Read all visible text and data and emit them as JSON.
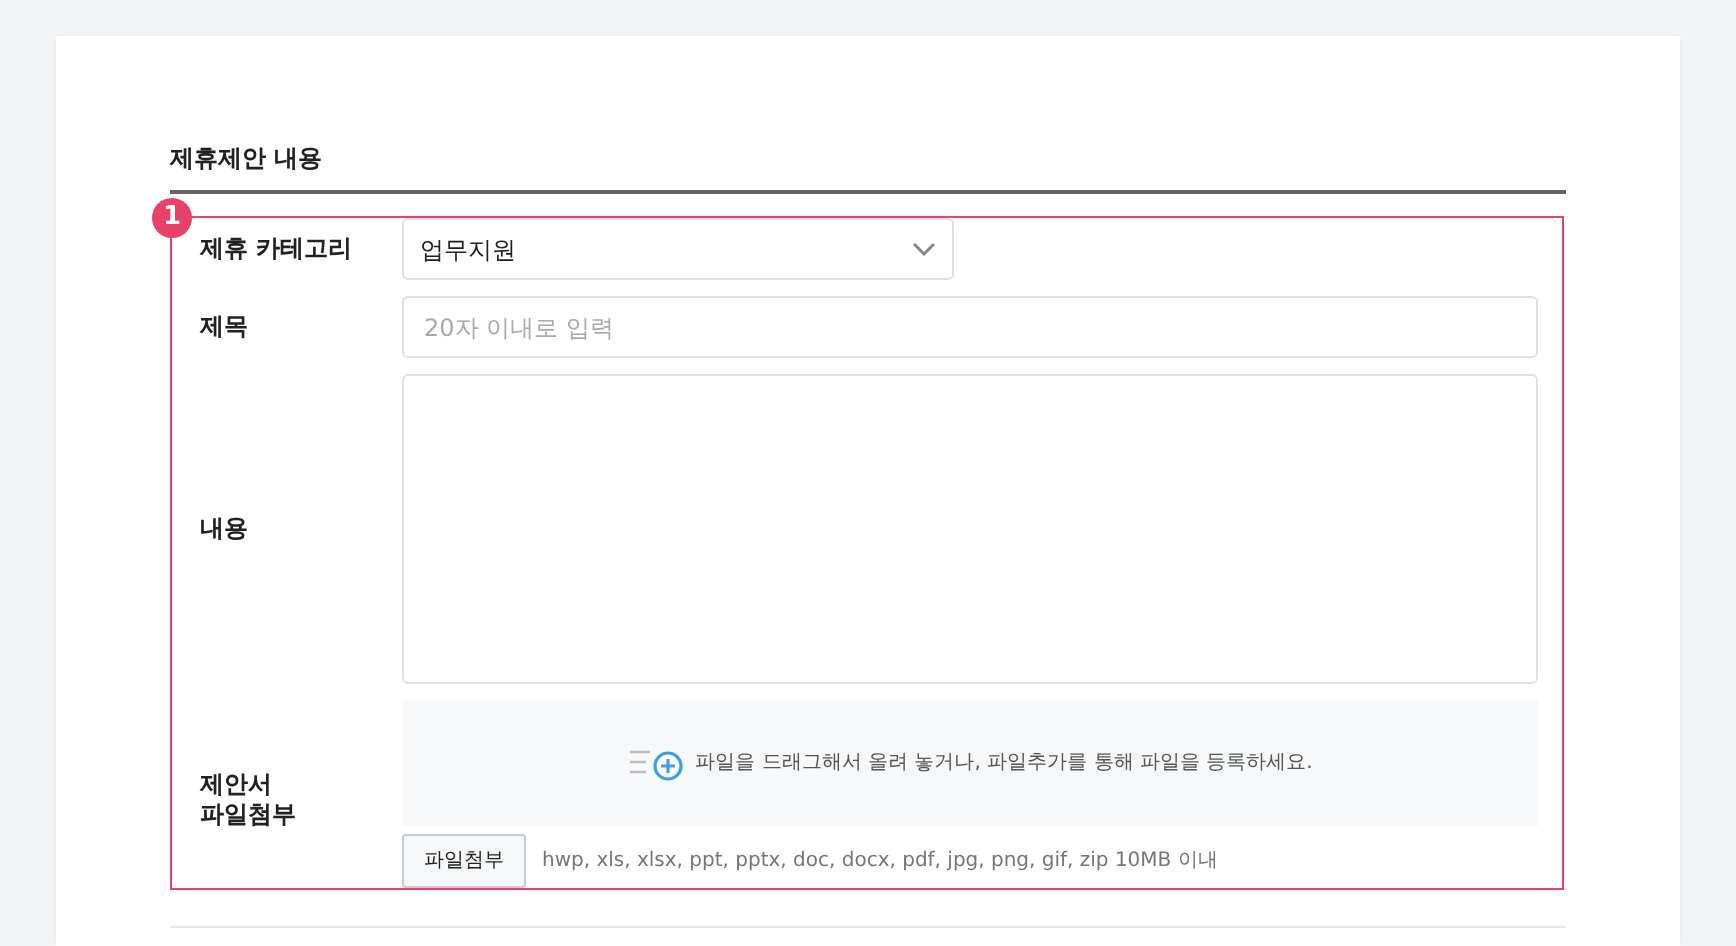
{
  "section_title": "제휴제안 내용",
  "marker": "1",
  "fields": [
    {
      "kind": "select",
      "label": "제휴 카테고리",
      "value": "업무지원"
    },
    {
      "kind": "input",
      "label": "제목",
      "placeholder": "20자 이내로 입력"
    },
    {
      "kind": "textarea",
      "label": "내용"
    },
    {
      "kind": "file",
      "label": "제안서\n파일첨부",
      "drop_text": "파일을 드래그해서 올려 놓거나, 파일추가를 통해 파일을 등록하세요.",
      "button": "파일첨부",
      "hint": "hwp, xls, xlsx, ppt, pptx, doc, docx, pdf, jpg, png, gif, zip 10MB 이내"
    }
  ]
}
